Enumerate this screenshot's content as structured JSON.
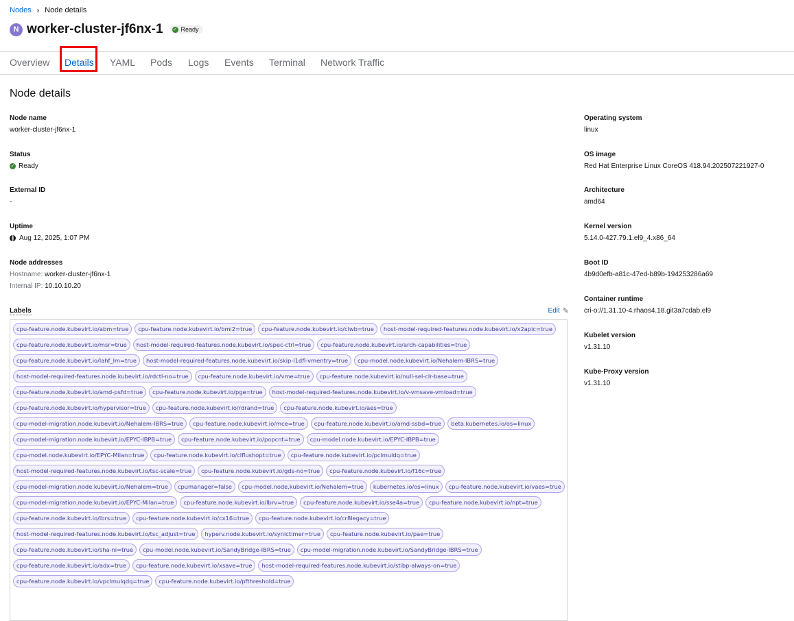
{
  "breadcrumb": {
    "parent": "Nodes",
    "current": "Node details"
  },
  "header": {
    "icon_letter": "N",
    "title": "worker-cluster-jf6nx-1",
    "status": "Ready"
  },
  "tabs": [
    "Overview",
    "Details",
    "YAML",
    "Pods",
    "Logs",
    "Events",
    "Terminal",
    "Network Traffic"
  ],
  "active_tab": "Details",
  "section_title": "Node details",
  "left_fields": {
    "node_name": {
      "label": "Node name",
      "value": "worker-cluster-jf6nx-1"
    },
    "status": {
      "label": "Status",
      "value": "Ready"
    },
    "external_id": {
      "label": "External ID",
      "value": "-"
    },
    "uptime": {
      "label": "Uptime",
      "value": "Aug 12, 2025, 1:07 PM"
    },
    "addresses": {
      "label": "Node addresses",
      "hostname_label": "Hostname:",
      "hostname": "worker-cluster-jf6nx-1",
      "ip_label": "Internal IP:",
      "ip": "10.10.10.20"
    }
  },
  "right_fields": {
    "os": {
      "label": "Operating system",
      "value": "linux"
    },
    "os_image": {
      "label": "OS image",
      "value": "Red Hat Enterprise Linux CoreOS 418.94.202507221927-0"
    },
    "architecture": {
      "label": "Architecture",
      "value": "amd64"
    },
    "kernel": {
      "label": "Kernel version",
      "value": "5.14.0-427.79.1.el9_4.x86_64"
    },
    "boot_id": {
      "label": "Boot ID",
      "value": "4b9d0efb-a81c-47ed-b89b-194253286a69"
    },
    "runtime": {
      "label": "Container runtime",
      "value": "cri-o://1.31.10-4.rhaos4.18.git3a7cdab.el9"
    },
    "kubelet": {
      "label": "Kubelet version",
      "value": "v1.31.10"
    },
    "kube_proxy": {
      "label": "Kube-Proxy version",
      "value": "v1.31.10"
    }
  },
  "labels": {
    "title": "Labels",
    "edit": "Edit",
    "items": [
      "cpu-feature.node.kubevirt.io/abm=true",
      "cpu-feature.node.kubevirt.io/bmi2=true",
      "cpu-feature.node.kubevirt.io/clwb=true",
      "host-model-required-features.node.kubevirt.io/x2apic=true",
      "cpu-feature.node.kubevirt.io/msr=true",
      "host-model-required-features.node.kubevirt.io/spec-ctrl=true",
      "cpu-feature.node.kubevirt.io/arch-capabilities=true",
      "cpu-feature.node.kubevirt.io/lahf_lm=true",
      "host-model-required-features.node.kubevirt.io/skip-l1dfl-vmentry=true",
      "cpu-model.node.kubevirt.io/Nehalem-IBRS=true",
      "host-model-required-features.node.kubevirt.io/rdctl-no=true",
      "cpu-feature.node.kubevirt.io/vme=true",
      "cpu-feature.node.kubevirt.io/null-sel-clr-base=true",
      "cpu-feature.node.kubevirt.io/amd-psfd=true",
      "cpu-feature.node.kubevirt.io/pge=true",
      "host-model-required-features.node.kubevirt.io/v-vmsave-vmload=true",
      "cpu-feature.node.kubevirt.io/hypervisor=true",
      "cpu-feature.node.kubevirt.io/rdrand=true",
      "cpu-feature.node.kubevirt.io/aes=true",
      "cpu-model-migration.node.kubevirt.io/Nehalem-IBRS=true",
      "cpu-feature.node.kubevirt.io/mce=true",
      "cpu-feature.node.kubevirt.io/amd-ssbd=true",
      "beta.kubernetes.io/os=linux",
      "cpu-model-migration.node.kubevirt.io/EPYC-IBPB=true",
      "cpu-feature.node.kubevirt.io/popcnt=true",
      "cpu-model.node.kubevirt.io/EPYC-IBPB=true",
      "cpu-model.node.kubevirt.io/EPYC-Milan=true",
      "cpu-feature.node.kubevirt.io/clflushopt=true",
      "cpu-feature.node.kubevirt.io/pclmuldq=true",
      "host-model-required-features.node.kubevirt.io/tsc-scale=true",
      "cpu-feature.node.kubevirt.io/gds-no=true",
      "cpu-feature.node.kubevirt.io/f16c=true",
      "cpu-model-migration.node.kubevirt.io/Nehalem=true",
      "cpumanager=false",
      "cpu-model.node.kubevirt.io/Nehalem=true",
      "kubernetes.io/os=linux",
      "cpu-feature.node.kubevirt.io/vaes=true",
      "cpu-model-migration.node.kubevirt.io/EPYC-Milan=true",
      "cpu-feature.node.kubevirt.io/lbrv=true",
      "cpu-feature.node.kubevirt.io/sse4a=true",
      "cpu-feature.node.kubevirt.io/npt=true",
      "cpu-feature.node.kubevirt.io/ibrs=true",
      "cpu-feature.node.kubevirt.io/cx16=true",
      "cpu-feature.node.kubevirt.io/cr8legacy=true",
      "host-model-required-features.node.kubevirt.io/tsc_adjust=true",
      "hyperv.node.kubevirt.io/synictimer=true",
      "cpu-feature.node.kubevirt.io/pae=true",
      "cpu-feature.node.kubevirt.io/sha-ni=true",
      "cpu-model.node.kubevirt.io/SandyBridge-IBRS=true",
      "cpu-model-migration.node.kubevirt.io/SandyBridge-IBRS=true",
      "cpu-feature.node.kubevirt.io/adx=true",
      "cpu-feature.node.kubevirt.io/xsave=true",
      "host-model-required-features.node.kubevirt.io/stibp-always-on=true",
      "cpu-feature.node.kubevirt.io/vpclmulqdq=true",
      "cpu-feature.node.kubevirt.io/pfthreshold=true"
    ]
  }
}
